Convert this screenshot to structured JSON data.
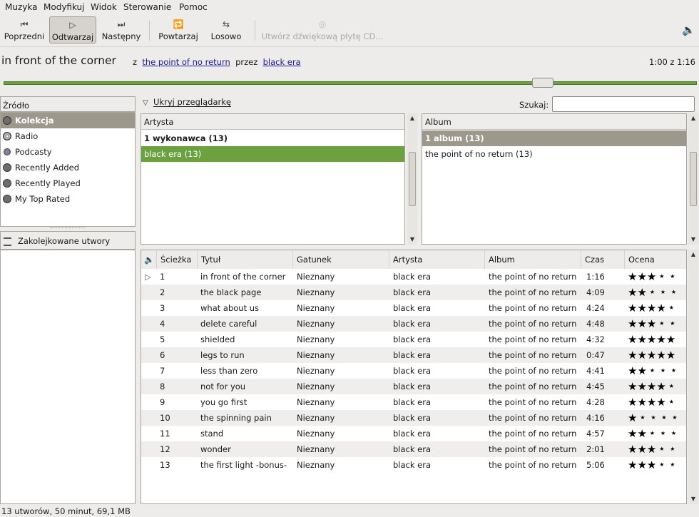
{
  "menu": [
    "Muzyka",
    "Modyfikuj",
    "Widok",
    "Sterowanie",
    "Pomoc"
  ],
  "toolbar": {
    "previous": "Poprzedni",
    "play": "Odtwarzaj",
    "next": "Następny",
    "repeat": "Powtarzaj",
    "shuffle": "Losowo",
    "burn_cd": "Utwórz dźwiękową płytę CD..."
  },
  "now_playing": {
    "title": "in front of the corner",
    "from_label": "z",
    "album": "the point of no return",
    "by_label": "przez",
    "artist": "black era",
    "time": "1:00 z 1:16",
    "progress": 0.79
  },
  "sources": {
    "header": "Źródło",
    "items": [
      {
        "label": "Kolekcja",
        "icon": "library-icon",
        "selected": true
      },
      {
        "label": "Radio",
        "icon": "radio-icon",
        "selected": false
      },
      {
        "label": "Podcasty",
        "icon": "podcast-icon",
        "selected": false
      },
      {
        "label": "Recently Added",
        "icon": "playlist-icon",
        "selected": false
      },
      {
        "label": "Recently Played",
        "icon": "playlist-icon",
        "selected": false
      },
      {
        "label": "My Top Rated",
        "icon": "playlist-icon",
        "selected": false
      }
    ],
    "queue_header": "Zakolejkowane utwory"
  },
  "browser": {
    "hide_label": "Ukryj przeglądarkę",
    "search_label": "Szukaj:",
    "search_value": "",
    "artist_header": "Artysta",
    "artist_rows": [
      "1 wykonawca (13)",
      "black era (13)"
    ],
    "album_header": "Album",
    "album_rows": [
      "1 album (13)",
      "the point of no return (13)"
    ]
  },
  "tracks": {
    "columns": [
      "Ścieżka",
      "Tytuł",
      "Gatunek",
      "Artysta",
      "Album",
      "Czas",
      "Ocena"
    ],
    "rows": [
      {
        "n": "1",
        "title": "in front of the corner",
        "genre": "Nieznany",
        "artist": "black era",
        "album": "the point of no return",
        "time": "1:16",
        "rating": 3,
        "playing": true
      },
      {
        "n": "2",
        "title": "the black page",
        "genre": "Nieznany",
        "artist": "black era",
        "album": "the point of no return",
        "time": "4:09",
        "rating": 2
      },
      {
        "n": "3",
        "title": "what about us",
        "genre": "Nieznany",
        "artist": "black era",
        "album": "the point of no return",
        "time": "4:24",
        "rating": 4
      },
      {
        "n": "4",
        "title": "delete careful",
        "genre": "Nieznany",
        "artist": "black era",
        "album": "the point of no return",
        "time": "4:48",
        "rating": 3
      },
      {
        "n": "5",
        "title": "shielded",
        "genre": "Nieznany",
        "artist": "black era",
        "album": "the point of no return",
        "time": "4:32",
        "rating": 5
      },
      {
        "n": "6",
        "title": "legs to run",
        "genre": "Nieznany",
        "artist": "black era",
        "album": "the point of no return",
        "time": "0:47",
        "rating": 5
      },
      {
        "n": "7",
        "title": "less than zero",
        "genre": "Nieznany",
        "artist": "black era",
        "album": "the point of no return",
        "time": "4:41",
        "rating": 2
      },
      {
        "n": "8",
        "title": "not for you",
        "genre": "Nieznany",
        "artist": "black era",
        "album": "the point of no return",
        "time": "4:45",
        "rating": 4
      },
      {
        "n": "9",
        "title": "you go first",
        "genre": "Nieznany",
        "artist": "black era",
        "album": "the point of no return",
        "time": "4:28",
        "rating": 4
      },
      {
        "n": "10",
        "title": "the spinning pain",
        "genre": "Nieznany",
        "artist": "black era",
        "album": "the point of no return",
        "time": "4:16",
        "rating": 1
      },
      {
        "n": "11",
        "title": "stand",
        "genre": "Nieznany",
        "artist": "black era",
        "album": "the point of no return",
        "time": "4:57",
        "rating": 2
      },
      {
        "n": "12",
        "title": "wonder",
        "genre": "Nieznany",
        "artist": "black era",
        "album": "the point of no return",
        "time": "2:01",
        "rating": 3
      },
      {
        "n": "13",
        "title": "the first light -bonus-",
        "genre": "Nieznany",
        "artist": "black era",
        "album": "the point of no return",
        "time": "5:06",
        "rating": 3
      }
    ]
  },
  "status": "13 utworów, 50 minut, 69,1 MB"
}
